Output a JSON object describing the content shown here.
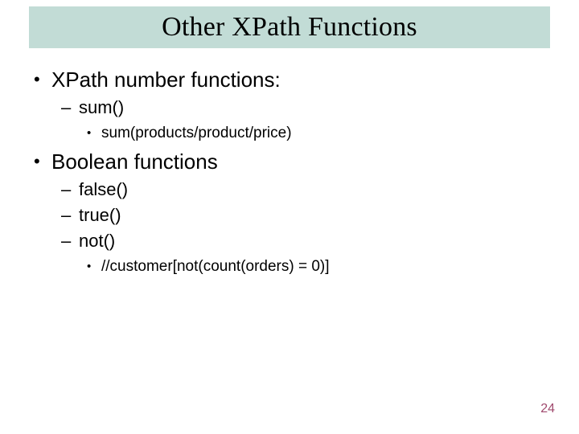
{
  "title": "Other XPath Functions",
  "bullets": {
    "b1": {
      "label": "XPath number functions:",
      "s1": {
        "label": "sum()",
        "d1": "sum(products/product/price)"
      }
    },
    "b2": {
      "label": "Boolean functions",
      "s1": {
        "label": "false()"
      },
      "s2": {
        "label": "true()"
      },
      "s3": {
        "label": "not()",
        "d1": "//customer[not(count(orders) = 0)]"
      }
    }
  },
  "page_number": "24"
}
